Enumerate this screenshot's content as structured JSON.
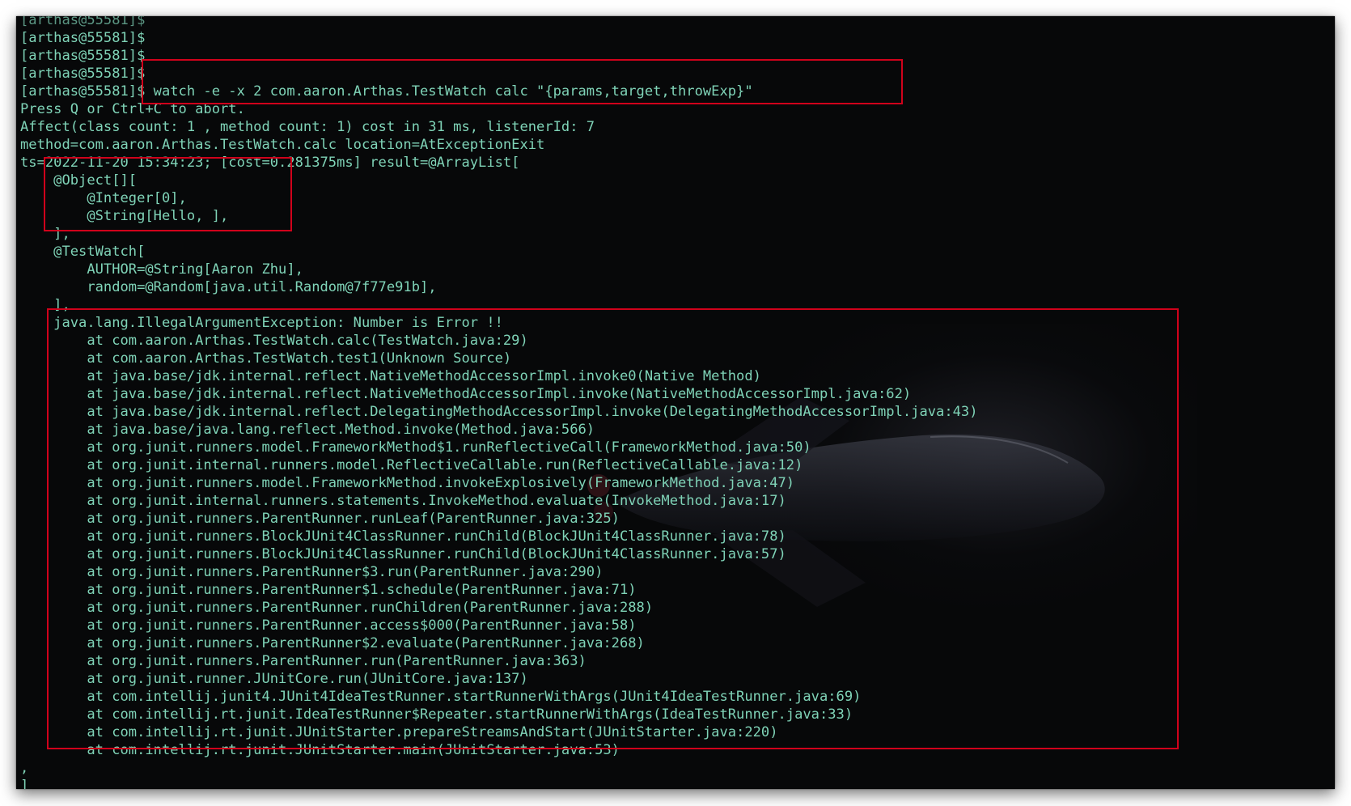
{
  "terminal": {
    "prompt_lines": [
      "[arthas@55581]$",
      "[arthas@55581]$",
      "[arthas@55581]$",
      "[arthas@55581]$ watch -e -x 2 com.aaron.Arthas.TestWatch calc \"{params,target,throwExp}\""
    ],
    "header_lines": [
      "Press Q or Ctrl+C to abort.",
      "Affect(class count: 1 , method count: 1) cost in 31 ms, listenerId: 7",
      "method=com.aaron.Arthas.TestWatch.calc location=AtExceptionExit",
      "ts=2022-11-20 15:34:23; [cost=0.281375ms] result=@ArrayList["
    ],
    "params_lines": [
      "    @Object[][",
      "        @Integer[0],",
      "        @String[Hello, ],",
      "    ],"
    ],
    "target_lines": [
      "    @TestWatch[",
      "        AUTHOR=@String[Aaron Zhu],",
      "        random=@Random[java.util.Random@7f77e91b],",
      "    ],"
    ],
    "exception_lines": [
      "    java.lang.IllegalArgumentException: Number is Error !!",
      "        at com.aaron.Arthas.TestWatch.calc(TestWatch.java:29)",
      "        at com.aaron.Arthas.TestWatch.test1(Unknown Source)",
      "        at java.base/jdk.internal.reflect.NativeMethodAccessorImpl.invoke0(Native Method)",
      "        at java.base/jdk.internal.reflect.NativeMethodAccessorImpl.invoke(NativeMethodAccessorImpl.java:62)",
      "        at java.base/jdk.internal.reflect.DelegatingMethodAccessorImpl.invoke(DelegatingMethodAccessorImpl.java:43)",
      "        at java.base/java.lang.reflect.Method.invoke(Method.java:566)",
      "        at org.junit.runners.model.FrameworkMethod$1.runReflectiveCall(FrameworkMethod.java:50)",
      "        at org.junit.internal.runners.model.ReflectiveCallable.run(ReflectiveCallable.java:12)",
      "        at org.junit.runners.model.FrameworkMethod.invokeExplosively(FrameworkMethod.java:47)",
      "        at org.junit.internal.runners.statements.InvokeMethod.evaluate(InvokeMethod.java:17)",
      "        at org.junit.runners.ParentRunner.runLeaf(ParentRunner.java:325)",
      "        at org.junit.runners.BlockJUnit4ClassRunner.runChild(BlockJUnit4ClassRunner.java:78)",
      "        at org.junit.runners.BlockJUnit4ClassRunner.runChild(BlockJUnit4ClassRunner.java:57)",
      "        at org.junit.runners.ParentRunner$3.run(ParentRunner.java:290)",
      "        at org.junit.runners.ParentRunner$1.schedule(ParentRunner.java:71)",
      "        at org.junit.runners.ParentRunner.runChildren(ParentRunner.java:288)",
      "        at org.junit.runners.ParentRunner.access$000(ParentRunner.java:58)",
      "        at org.junit.runners.ParentRunner$2.evaluate(ParentRunner.java:268)",
      "        at org.junit.runners.ParentRunner.run(ParentRunner.java:363)",
      "        at org.junit.runner.JUnitCore.run(JUnitCore.java:137)",
      "        at com.intellij.junit4.JUnit4IdeaTestRunner.startRunnerWithArgs(JUnit4IdeaTestRunner.java:69)",
      "        at com.intellij.rt.junit.IdeaTestRunner$Repeater.startRunnerWithArgs(IdeaTestRunner.java:33)",
      "        at com.intellij.rt.junit.JUnitStarter.prepareStreamsAndStart(JUnitStarter.java:220)",
      "        at com.intellij.rt.junit.JUnitStarter.main(JUnitStarter.java:53)"
    ],
    "footer_lines": [
      ",",
      "]"
    ]
  },
  "colors": {
    "terminal_text": "#7fd3b7",
    "terminal_bg": "#070809",
    "highlight_box": "#d0021b"
  },
  "background_image": "space-shuttle-wallpaper"
}
